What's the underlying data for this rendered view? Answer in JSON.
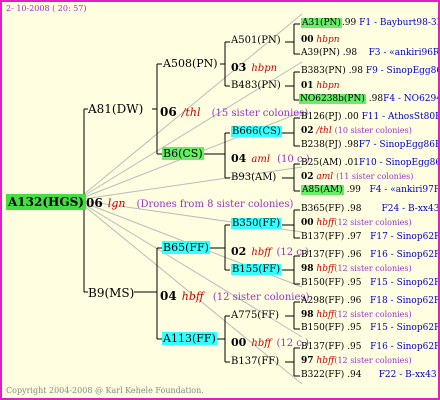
{
  "header": {
    "date": "2- 10-2008 ( 20: 57)"
  },
  "footer": {
    "copyright": "Copyright 2004-2008 @ Karl Kehele Foundation."
  },
  "root": {
    "id": "A132(HGS)",
    "num": "06",
    "sire": "lgn",
    "note": "(Drones from 8 sister colonies)"
  },
  "gen1": {
    "top": {
      "id": "A81(DW)",
      "num": "06",
      "sire": "/thl",
      "note": "(15 sister colonies)"
    },
    "bottom": {
      "id": "B9(MS)",
      "num": "04",
      "sire": "hbff",
      "note": "(12 sister colonies)"
    }
  },
  "gen2": {
    "a508": {
      "id": "A508(PN)",
      "num": "03",
      "sire": "hbpn"
    },
    "b6": {
      "id": "B6(CS)",
      "num": "04",
      "sire": "aml",
      "note": "(10 c.)"
    },
    "b65": {
      "id": "B65(FF)",
      "num": "02",
      "sire": "hbff",
      "note": "(12 c.)"
    },
    "a113": {
      "id": "A113(FF)",
      "num": "00",
      "sire": "hbff",
      "note": "(12 c.)"
    }
  },
  "gen3": {
    "a501": {
      "id": "A501(PN)",
      "num": "00",
      "sire": "hbpn"
    },
    "b483": {
      "id": "B483(PN)",
      "num": "01",
      "sire": "hbpn"
    },
    "b666": {
      "id": "B666(CS)",
      "num": "02",
      "sire": "/thl",
      "note": "(10 sister colonies)"
    },
    "b93": {
      "id": "B93(AM)",
      "num": "02",
      "sire": "aml",
      "note": "(11 sister colonies)"
    },
    "b350": {
      "id": "B350(FF)",
      "num": "00",
      "sire": "hbff",
      "note": "(12 sister colonies)"
    },
    "b155": {
      "id": "B155(FF)",
      "num": "98",
      "sire": "hbff",
      "note": "(12 sister colonies)"
    },
    "a775": {
      "id": "A775(FF)",
      "num": "98",
      "sire": "hbff",
      "note": "(12 sister colonies)"
    },
    "b137": {
      "id": "B137(FF)",
      "num": "97",
      "sire": "hbff",
      "note": "(12 sister colonies)"
    }
  },
  "gen4": [
    {
      "id": "A31(PN)",
      "yr": ".99",
      "pedigree": "F1 - Bayburt98-3R"
    },
    {
      "id": "A39(PN)",
      "yr": ".98",
      "pedigree": "F3 - «ankiri96R"
    },
    {
      "id": "B383(PN)",
      "yr": ".98",
      "pedigree": "F9 - SinopEgg86R"
    },
    {
      "id": "NO6238b(PN)",
      "yr": ".98",
      "pedigree": "F4 - NO6294R"
    },
    {
      "id": "B126(PJ)",
      "yr": ".00",
      "pedigree": "F11 - AthosSt80R"
    },
    {
      "id": "B238(PJ)",
      "yr": ".98",
      "pedigree": "F7 - SinopEgg86R"
    },
    {
      "id": "B25(AM)",
      "yr": ".01",
      "pedigree": "F10 - SinopEgg86R"
    },
    {
      "id": "A85(AM)",
      "yr": ".99",
      "pedigree": "F4 - «ankiri97R"
    },
    {
      "id": "B365(FF)",
      "yr": ".98",
      "pedigree": "F24 - B-xx43"
    },
    {
      "id": "B137(FF)",
      "yr": ".97",
      "pedigree": "F17 - Sinop62R"
    },
    {
      "id": "B137(FF)",
      "yr": ".96",
      "pedigree": "F16 - Sinop62R"
    },
    {
      "id": "B150(FF)",
      "yr": ".95",
      "pedigree": "F15 - Sinop62R"
    },
    {
      "id": "A298(FF)",
      "yr": ".96",
      "pedigree": "F18 - Sinop62R"
    },
    {
      "id": "B150(FF)",
      "yr": ".95",
      "pedigree": "F15 - Sinop62R"
    },
    {
      "id": "B137(FF)",
      "yr": ".95",
      "pedigree": "F16 - Sinop62R"
    },
    {
      "id": "B322(FF)",
      "yr": ".94",
      "pedigree": "F22 - B-xx43"
    }
  ]
}
